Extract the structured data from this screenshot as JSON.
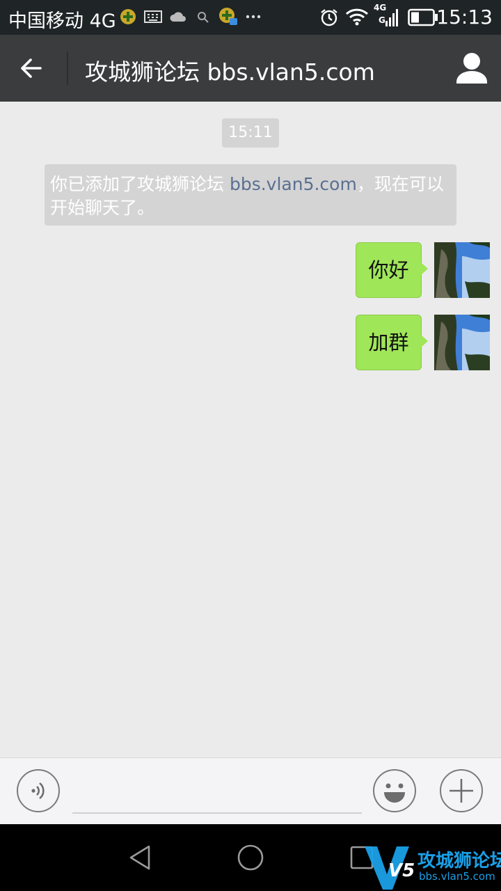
{
  "status_bar": {
    "carrier": "中国移动 4G",
    "network_small": "4G",
    "network_small2": "G",
    "time": "15:13"
  },
  "app_bar": {
    "title": "攻城狮论坛 bbs.vlan5.com"
  },
  "chat": {
    "timestamp": "15:11",
    "system_message_prefix": "你已添加了攻城狮论坛 ",
    "system_message_link": "bbs.vlan5.com",
    "system_message_suffix": "，现在可以开始聊天了。",
    "messages": [
      {
        "text": "你好",
        "sender": "me"
      },
      {
        "text": "加群",
        "sender": "me"
      }
    ]
  },
  "input_bar": {
    "value": ""
  },
  "watermark": {
    "title": "攻城狮论坛",
    "subtitle": "bbs.vlan5.com",
    "logo_text": "V5"
  },
  "colors": {
    "status_bar_bg": "#1f2426",
    "app_bar_bg": "#3a3c3e",
    "chat_bg": "#ebebeb",
    "bubble_green": "#9fe658",
    "system_pill": "#d4d4d4",
    "link": "#5a6f92",
    "watermark_blue": "#1aa0e8"
  }
}
